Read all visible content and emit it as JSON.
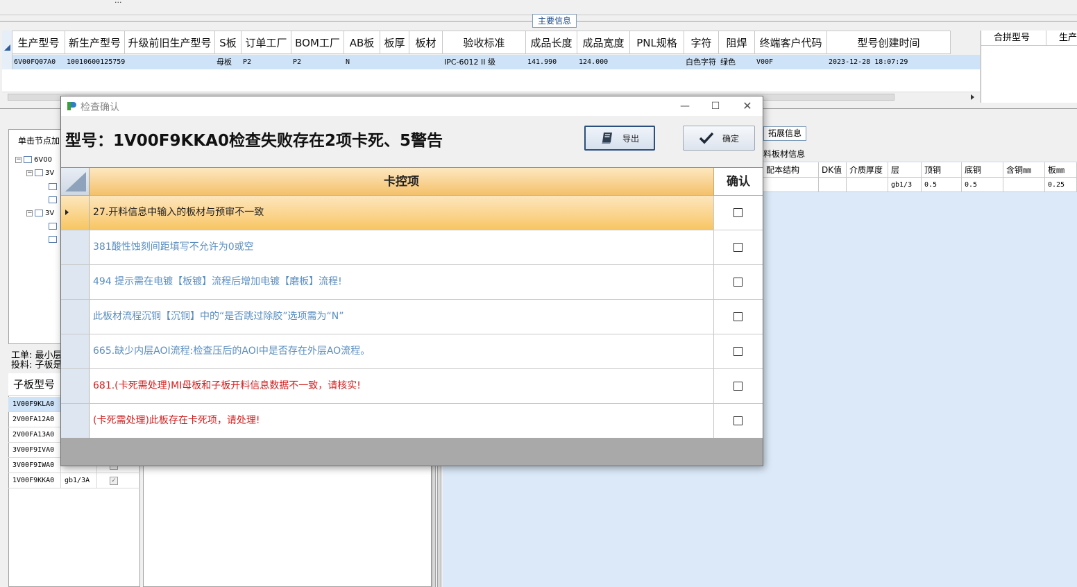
{
  "app": {
    "top_fragment": "...",
    "section_tab": "主要信息",
    "main_grid": {
      "columns": [
        "生产型号",
        "新生产型号",
        "升级前旧生产型号",
        "S板",
        "订单工厂",
        "BOM工厂",
        "AB板",
        "板厚",
        "板材",
        "验收标准",
        "成品长度",
        "成品宽度",
        "PNL规格",
        "字符",
        "阻焊",
        "终端客户代码",
        "型号创建时间"
      ],
      "row": [
        "6V00FQ07A0",
        "10010600125759",
        "",
        "母板",
        "P2",
        "P2",
        "N",
        "",
        "",
        "IPC-6012 II 级",
        "141.990",
        "124.000",
        "",
        "白色字符",
        "绿色",
        "V00F",
        "2023-12-28 18:07:29"
      ]
    },
    "right_panel_headers": [
      "合拼型号",
      "生产"
    ],
    "tree_title": "单击节点加",
    "tree_nodes": [
      "6V00",
      "3V",
      "3V"
    ],
    "info_lines": [
      "工单: 最小层",
      "投料: 子板是"
    ],
    "sub_grid": {
      "header": "子板型号",
      "rows": [
        {
          "model": "1V00F9KLA0",
          "code": "",
          "checked": false
        },
        {
          "model": "2V00FA12A0",
          "code": "",
          "checked": false
        },
        {
          "model": "2V00FA13A0",
          "code": "",
          "checked": false
        },
        {
          "model": "3V00F9IVA0",
          "code": "",
          "checked": false
        },
        {
          "model": "3V00F9IWA0",
          "code": "",
          "checked": false
        },
        {
          "model": "1V00F9KKA0",
          "code": "gb1/3A",
          "checked": true
        }
      ]
    },
    "ext_tab": "拓展信息",
    "ext_label": "料板材信息",
    "ext_grid": {
      "columns": [
        "配本结构",
        "DK值",
        "介质厚度",
        "层",
        "顶铜",
        "底铜",
        "含铜㎜",
        "板㎜"
      ],
      "row": [
        "",
        "",
        "",
        "gb1/3",
        "0.5",
        "0.5",
        "",
        "0.25"
      ]
    }
  },
  "dialog": {
    "title": "检查确认",
    "heading": "型号：1V00F9KKA0检查失败存在2项卡死、5警告",
    "export_label": "导出",
    "confirm_label": "确定",
    "col_item": "卡控项",
    "col_confirm": "确认",
    "items": [
      {
        "text": "27.开料信息中输入的板材与预审不一致",
        "level": "selected"
      },
      {
        "text": "381酸性蚀刻间距填写不允许为0或空",
        "level": "warn"
      },
      {
        "text": "494 提示需在电镀【板镀】流程后增加电镀【磨板】流程!",
        "level": "warn"
      },
      {
        "text": "此板材流程沉铜【沉铜】中的“是否跳过除胶”选项需为“N”",
        "level": "warn"
      },
      {
        "text": "665.缺少内层AOI流程:检查压后的AOI中是否存在外层AO流程。",
        "level": "warn"
      },
      {
        "text": "681.(卡死需处理)MI母板和子板开料信息数据不一致，请核实!",
        "level": "fatal"
      },
      {
        "text": "(卡死需处理)此板存在卡死项，请处理!",
        "level": "fatal"
      }
    ],
    "colors": {
      "warn": "#5a8ec0",
      "fatal": "#d41e1e",
      "header": "#f4c16a"
    }
  }
}
